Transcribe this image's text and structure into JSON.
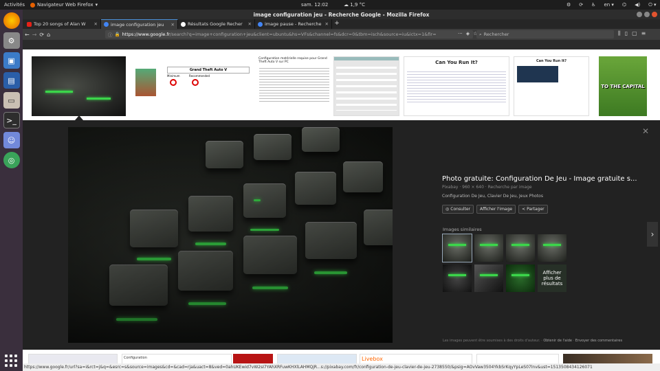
{
  "os": {
    "activities": "Activités",
    "app_name": "Navigateur Web Firefox",
    "clock": "sam. 12:02",
    "weather": "1,9 °C",
    "language": "en"
  },
  "window": {
    "title": "image configuration jeu - Recherche Google - Mozilla Firefox"
  },
  "tabs": [
    {
      "label": "Top 20 songs of Alan W",
      "icon_color": "#e62117"
    },
    {
      "label": "image configuration jeu",
      "icon_color": "#4285f4"
    },
    {
      "label": "Résultats Google Recher",
      "icon_color": "#ffffff"
    },
    {
      "label": "image pause - Recherche",
      "icon_color": "#4285f4"
    }
  ],
  "urlbar": {
    "domain": "https://www.google.fr",
    "path": "/search?q=image+configuration+jeu&client=ubuntu&hs=VFs&channel=fs&dcr=0&tbm=isch&source=iu&ictx=1&fir="
  },
  "search": {
    "placeholder": "Rechercher"
  },
  "viewer": {
    "title": "Photo gratuite: Configuration De Jeu - Image gratuite s...",
    "meta": "Pixabay · 960 × 640 · Recherche par image",
    "tags": "Configuration De Jeu, Clavier De Jeu, Jeux Photos",
    "btn_visit": "Consulter",
    "btn_view": "Afficher l'image",
    "btn_share": "Partager",
    "similar_label": "Images similaires",
    "more_results": "Afficher plus de résultats",
    "copyright": "Les images peuvent être soumises à des droits d'auteur.",
    "help": "Obtenir de l'aide",
    "feedback": "Envoyer des commentaires"
  },
  "thumbs": {
    "gta_title": "Grand Theft Auto V",
    "gta_minimum": "Minimum",
    "gta_recommended": "Recommended",
    "canyourunit": "Can You Run It?",
    "capital": "TO THE CAPITAL",
    "config_title": "Configuration matérielle requise pour Grand Theft Auto V sur PC"
  },
  "bottom": {
    "config_label": "Configuration",
    "livebox": "Livebox"
  },
  "statusbar": "https://www.google.fr/url?sa=i&rct=j&q=&esrc=s&source=images&cd=&cad=rja&uact=8&ved=0ahUKEwid7vW2sI7YAhXRFuwKHXlLAHMQjR...s://pixabay.com/fr/configuration-de-jeu-clavier-de-jeu-2738550/&psig=AOvVaw3504YkbSrKqyYpLeS07lnv&ust=1513508434126071"
}
